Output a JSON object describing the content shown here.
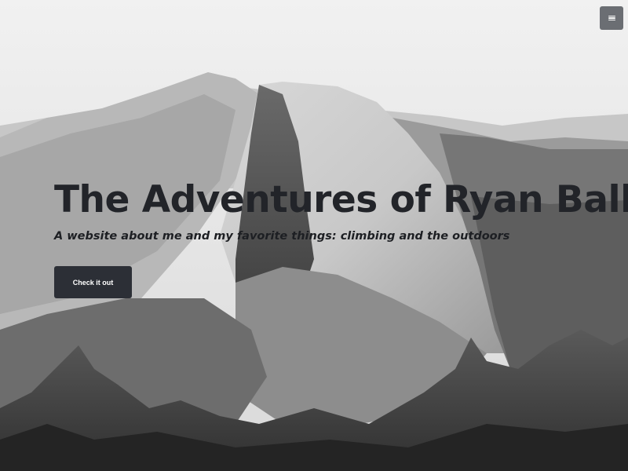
{
  "header": {
    "menu_icon": "hamburger-menu-icon"
  },
  "hero": {
    "title": "The Adventures of Ryan Ball",
    "subtitle": "A website about me and my favorite things: climbing and the outdoors",
    "cta_label": "Check it out"
  },
  "colors": {
    "title_text": "#222429",
    "button_bg": "#2c2f36",
    "menu_button_bg": "#6b6e73"
  }
}
